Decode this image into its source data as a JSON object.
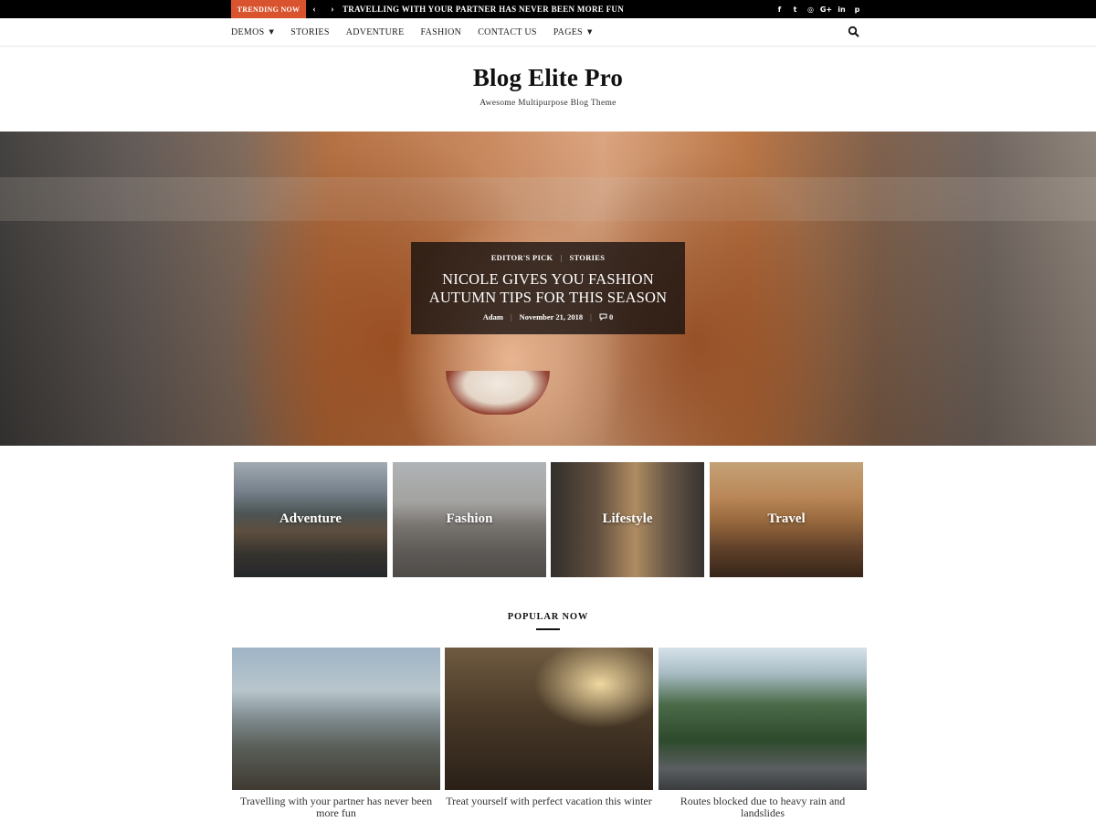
{
  "topbar": {
    "trending_label": "TRENDING NOW",
    "prev_icon": "chevron-left-icon",
    "next_icon": "chevron-right-icon",
    "ticker_text": "TRAVELLING WITH YOUR PARTNER HAS NEVER BEEN MORE FUN",
    "socials": [
      {
        "name": "facebook-icon",
        "glyph": "f"
      },
      {
        "name": "twitter-icon",
        "glyph": "t"
      },
      {
        "name": "instagram-icon",
        "glyph": "◎"
      },
      {
        "name": "google-plus-icon",
        "glyph": "G+"
      },
      {
        "name": "linkedin-icon",
        "glyph": "in"
      },
      {
        "name": "pinterest-icon",
        "glyph": "p"
      }
    ]
  },
  "nav": {
    "items": [
      {
        "label": "DEMOS",
        "has_dropdown": true
      },
      {
        "label": "STORIES",
        "has_dropdown": false
      },
      {
        "label": "ADVENTURE",
        "has_dropdown": false
      },
      {
        "label": "FASHION",
        "has_dropdown": false
      },
      {
        "label": "CONTACT US",
        "has_dropdown": false
      },
      {
        "label": "PAGES",
        "has_dropdown": true
      }
    ],
    "search_icon": "search-icon"
  },
  "branding": {
    "site_title": "Blog Elite Pro",
    "tagline": "Awesome Multipurpose Blog Theme"
  },
  "hero": {
    "categories": [
      "EDITOR'S PICK",
      "STORIES"
    ],
    "title": "NICOLE GIVES YOU FASHION AUTUMN TIPS FOR THIS SEASON",
    "author": "Adam",
    "date": "November 21, 2018",
    "comments": "0",
    "comment_icon": "comment-icon"
  },
  "categories": [
    {
      "label": "Adventure"
    },
    {
      "label": "Fashion"
    },
    {
      "label": "Lifestyle"
    },
    {
      "label": "Travel"
    }
  ],
  "popular": {
    "heading": "POPULAR NOW",
    "posts": [
      {
        "title": "Travelling with your partner has never been more fun"
      },
      {
        "title": "Treat yourself with perfect vacation this winter"
      },
      {
        "title": "Routes blocked due to heavy rain and landslides"
      }
    ]
  },
  "colors": {
    "accent": "#d9532e",
    "topbar_bg": "#000000"
  }
}
